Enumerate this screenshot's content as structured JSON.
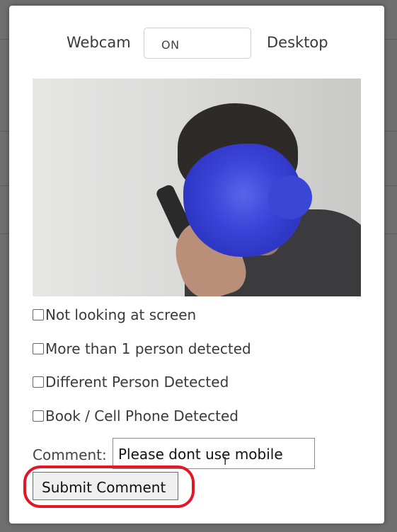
{
  "toggle": {
    "left_label": "Webcam",
    "state": "ON",
    "right_label": "Desktop"
  },
  "checkboxes": [
    {
      "label": "Not looking at screen",
      "checked": false
    },
    {
      "label": "More than 1 person detected",
      "checked": false
    },
    {
      "label": "Different Person Detected",
      "checked": false
    },
    {
      "label": "Book / Cell Phone Detected",
      "checked": false
    }
  ],
  "comment": {
    "label": "Comment:",
    "value": "Please dont use mobile"
  },
  "submit_label": "Submit Comment",
  "colors": {
    "highlight": "#e0192a",
    "face_blur": "#3a44d8"
  }
}
